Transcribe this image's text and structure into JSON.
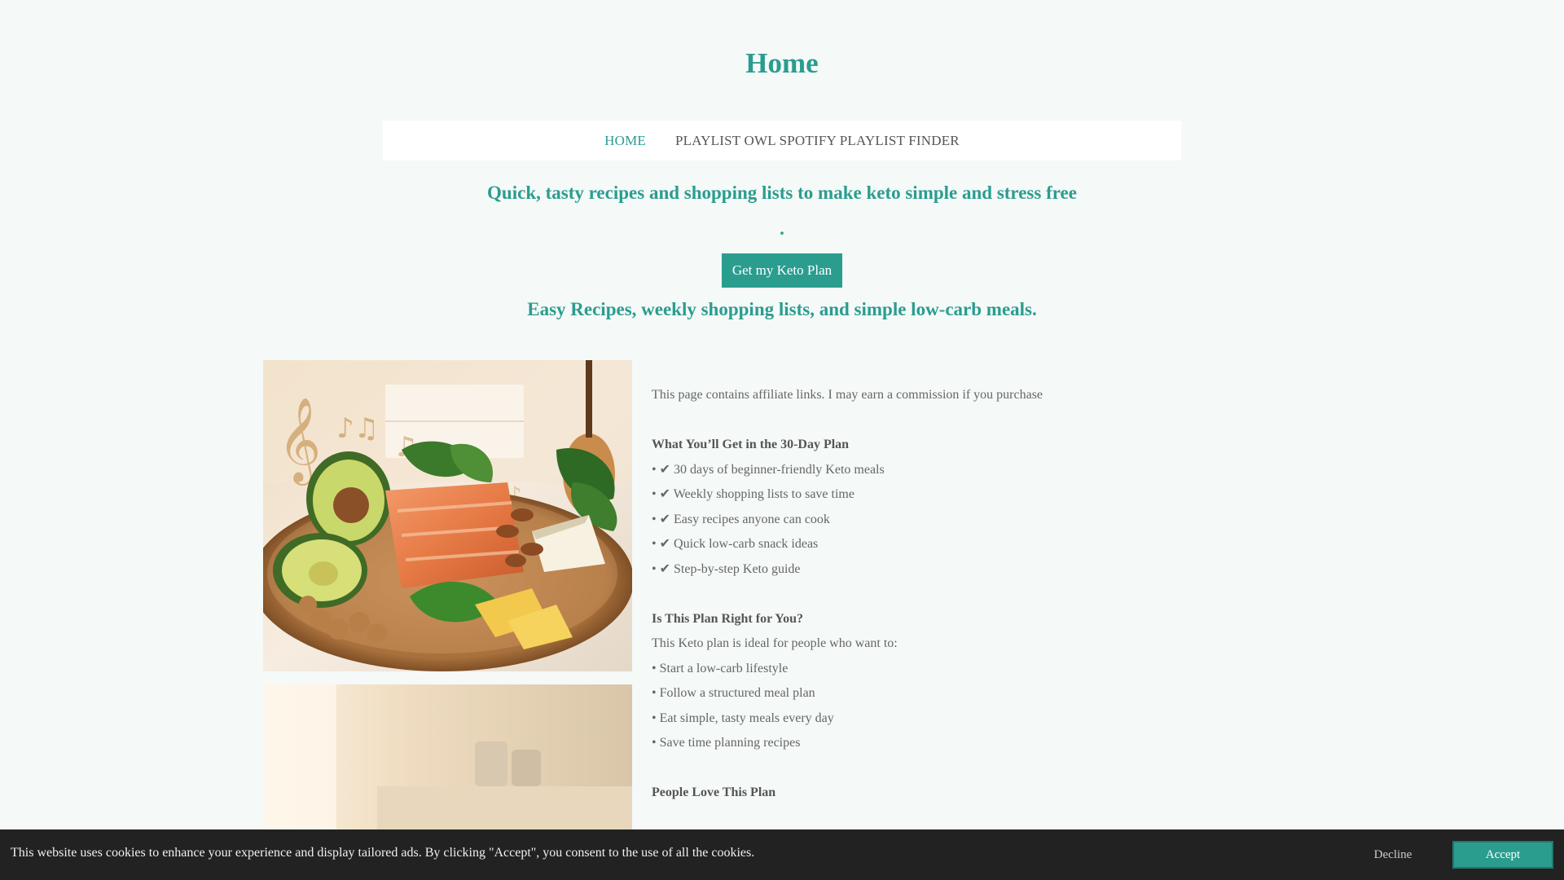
{
  "site": {
    "title": "Home"
  },
  "nav": {
    "items": [
      {
        "label": "HOME"
      },
      {
        "label": "PLAYLIST OWL SPOTIFY PLAYLIST FINDER"
      }
    ]
  },
  "hero": {
    "tagline": "Quick, tasty recipes and shopping lists to make keto simple and stress free",
    "dot": ".",
    "cta_label": "Get my Keto Plan",
    "subtagline": "Easy Recipes, weekly shopping lists, and simple low-carb meals."
  },
  "content": {
    "disclaimer": "This page contains affiliate links. I may earn a commission if you purchase",
    "plan_heading": "What You’ll Get in the 30-Day Plan",
    "plan_items": [
      "• ✔ 30 days of beginner-friendly Keto meals",
      "• ✔ Weekly shopping lists to save time",
      "• ✔ Easy recipes anyone can cook",
      "• ✔ Quick low-carb snack ideas",
      "• ✔ Step-by-step Keto guide"
    ],
    "fit_heading": "Is This Plan Right for You?",
    "fit_intro": "This Keto plan is ideal for people who want to:",
    "fit_items": [
      "• Start a low-carb lifestyle",
      "• Follow a structured meal plan",
      "• Eat simple, tasty meals every day",
      "• Save time planning recipes"
    ],
    "love_heading": "People Love This Plan"
  },
  "cookie": {
    "text": "This website uses cookies to enhance your experience and display tailored ads. By clicking \"Accept\", you consent to the use of all the cookies.",
    "decline_label": "Decline",
    "accept_label": "Accept"
  },
  "colors": {
    "accent": "#2a9d8f",
    "background": "#f5f9f8",
    "cookie_bar": "#222222"
  }
}
